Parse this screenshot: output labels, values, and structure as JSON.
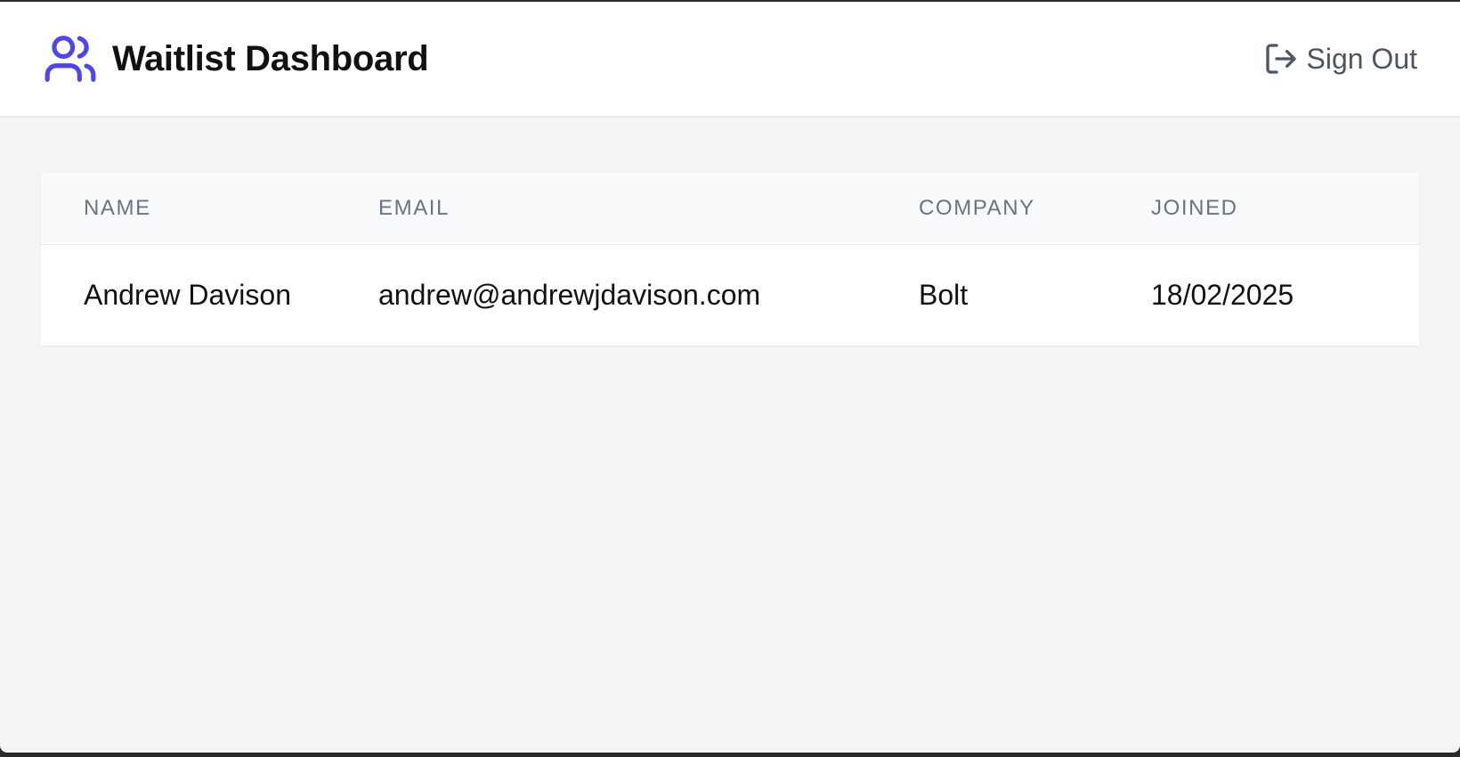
{
  "header": {
    "title": "Waitlist Dashboard",
    "logo_icon": "users-icon",
    "accent_color": "#4f46e5",
    "sign_out_label": "Sign Out",
    "sign_out_icon": "sign-out-icon"
  },
  "table": {
    "columns": [
      "NAME",
      "EMAIL",
      "COMPANY",
      "JOINED"
    ],
    "rows": [
      {
        "name": "Andrew Davison",
        "email": "andrew@andrewjdavison.com",
        "company": "Bolt",
        "joined": "18/02/2025"
      }
    ]
  }
}
